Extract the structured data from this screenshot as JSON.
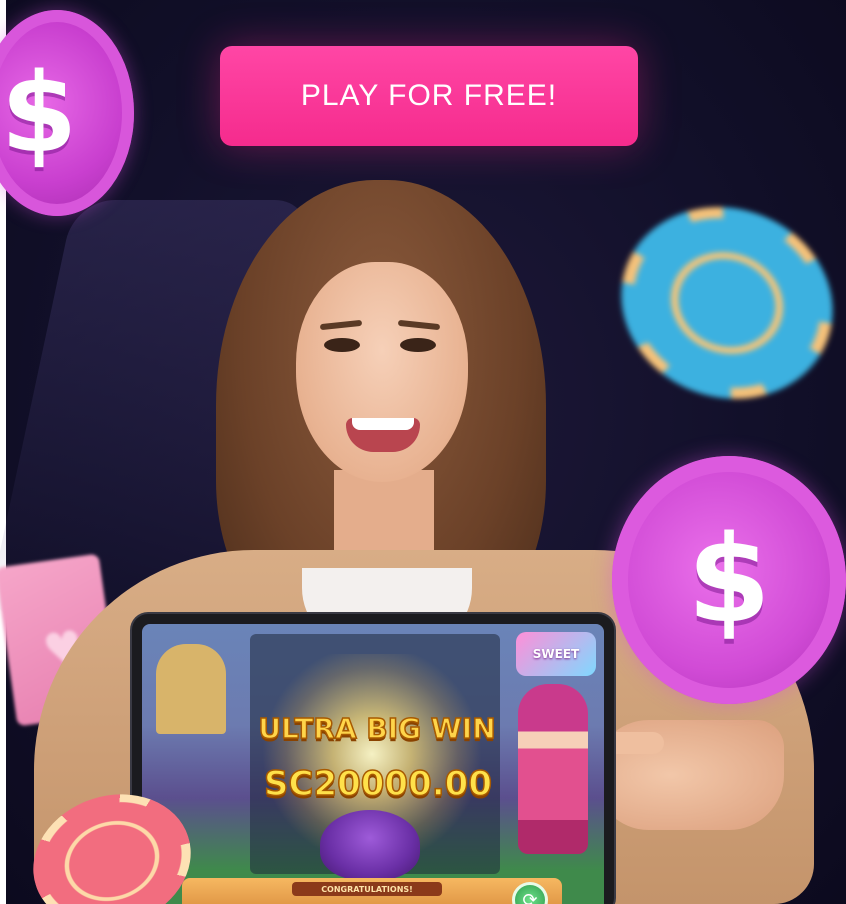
{
  "headline": {
    "prefix": "",
    "accent": "",
    "suffix": ""
  },
  "cta": {
    "label": "PLAY FOR FREE!"
  },
  "coins": {
    "symbol": "$"
  },
  "game": {
    "logo_text": "SWEET",
    "win_title": "ULTRA BIG WIN",
    "win_amount": "SC20000.00",
    "congrats_label": "CONGRATULATIONS!",
    "spin_symbol": "⟳"
  },
  "card": {
    "symbol": "♥"
  },
  "colors": {
    "cta_pink": "#f52b8d",
    "background": "#12102a",
    "coin_magenta": "#d14bd6",
    "chip_blue": "#3cb1e0",
    "win_gold": "#ffd54a"
  }
}
